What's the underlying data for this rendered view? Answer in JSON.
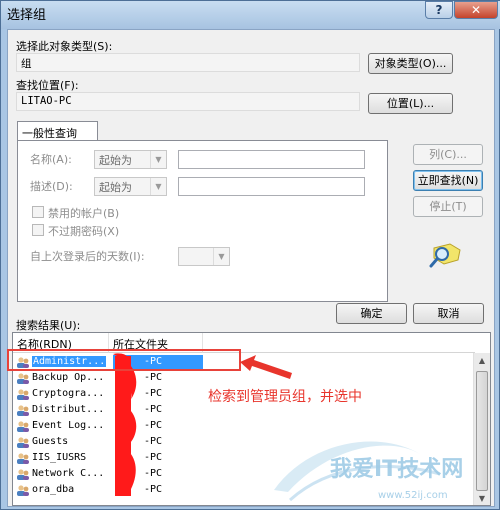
{
  "window": {
    "title": "选择组",
    "help_label": "?",
    "close_label": "✕"
  },
  "object_type": {
    "label": "选择此对象类型(S):",
    "value": "组",
    "button": "对象类型(O)..."
  },
  "location": {
    "label": "查找位置(F):",
    "value": "LITAO-PC",
    "button": "位置(L)..."
  },
  "query": {
    "tab_label": "一般性查询",
    "name_label": "名称(A):",
    "name_mode": "起始为",
    "desc_label": "描述(D):",
    "desc_mode": "起始为",
    "disabled_accounts": "禁用的帐户(B)",
    "non_expiring_pw": "不过期密码(X)",
    "days_since_logon": "自上次登录后的天数(I):"
  },
  "side_buttons": {
    "columns": "列(C)...",
    "find_now": "立即查找(N)",
    "stop": "停止(T)"
  },
  "dialog_buttons": {
    "ok": "确定",
    "cancel": "取消"
  },
  "results": {
    "label": "搜索结果(U):",
    "col_name": "名称(RDN)",
    "col_folder": "所在文件夹",
    "rows": [
      {
        "name": "Administr...",
        "folder": "-PC"
      },
      {
        "name": "Backup Op...",
        "folder": "-PC"
      },
      {
        "name": "Cryptogra...",
        "folder": "-PC"
      },
      {
        "name": "Distribut...",
        "folder": "-PC"
      },
      {
        "name": "Event Log...",
        "folder": "-PC"
      },
      {
        "name": "Guests",
        "folder": "-PC"
      },
      {
        "name": "IIS_IUSRS",
        "folder": "-PC"
      },
      {
        "name": "Network C...",
        "folder": "-PC"
      },
      {
        "name": "ora_dba",
        "folder": "-PC"
      }
    ]
  },
  "annotation": {
    "text": "检索到管理员组，并选中",
    "color": "#e8352c"
  },
  "watermark": {
    "text": "我爱IT技术网",
    "url": "www.52ij.com"
  },
  "colors": {
    "selection": "#3399ff",
    "accent": "#e8423a"
  }
}
